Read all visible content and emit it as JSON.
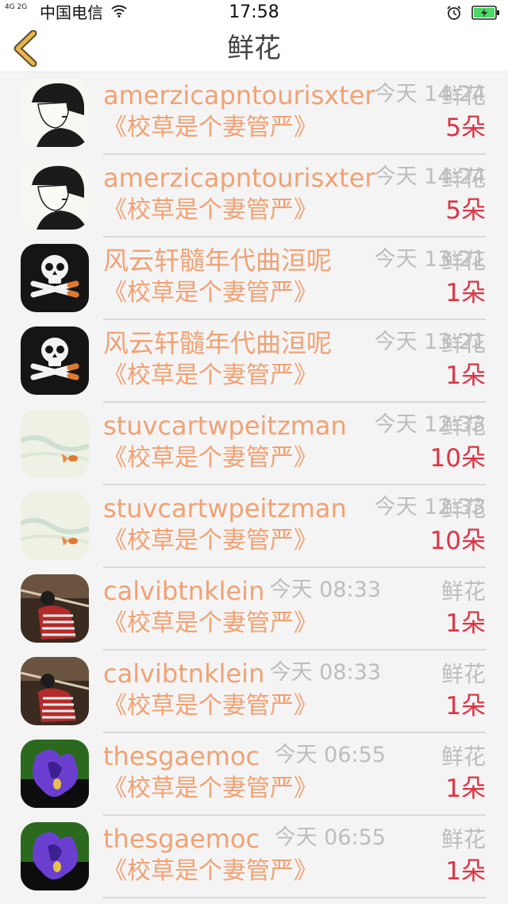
{
  "status_bar": {
    "network": "4G 2G",
    "carrier": "中国电信",
    "time": "17:58"
  },
  "header": {
    "title": "鲜花"
  },
  "colors": {
    "name": "#f0a274",
    "count": "#dc3545",
    "meta": "#bdbdbd",
    "back_icon": "#e8b64a"
  },
  "rows": [
    {
      "avatar": "avatar-manga-boy-icon",
      "name": "amerzicapntourisxter",
      "time": "今天 14:24",
      "label": "鲜花",
      "book": "《校草是个妻管严》",
      "count": "5朵"
    },
    {
      "avatar": "avatar-manga-boy-icon",
      "name": "amerzicapntourisxter",
      "time": "今天 14:24",
      "label": "鲜花",
      "book": "《校草是个妻管严》",
      "count": "5朵"
    },
    {
      "avatar": "avatar-skull-icon",
      "name": "风云轩髓年代曲洹呢",
      "time": "今天 13:21",
      "label": "鲜花",
      "book": "《校草是个妻管严》",
      "count": "1朵"
    },
    {
      "avatar": "avatar-skull-icon",
      "name": "风云轩髓年代曲洹呢",
      "time": "今天 13:21",
      "label": "鲜花",
      "book": "《校草是个妻管严》",
      "count": "1朵"
    },
    {
      "avatar": "avatar-goldfish-icon",
      "name": "stuvcartwpeitzman",
      "time": "今天 12:33",
      "label": "鲜花",
      "book": "《校草是个妻管严》",
      "count": "10朵"
    },
    {
      "avatar": "avatar-goldfish-icon",
      "name": "stuvcartwpeitzman",
      "time": "今天 12:33",
      "label": "鲜花",
      "book": "《校草是个妻管严》",
      "count": "10朵"
    },
    {
      "avatar": "avatar-photo-person-icon",
      "name": "calvibtnklein",
      "time": "今天 08:33",
      "label": "鲜花",
      "book": "《校草是个妻管严》",
      "count": "1朵"
    },
    {
      "avatar": "avatar-photo-person-icon",
      "name": "calvibtnklein",
      "time": "今天 08:33",
      "label": "鲜花",
      "book": "《校草是个妻管严》",
      "count": "1朵"
    },
    {
      "avatar": "avatar-purple-flower-icon",
      "name": "thesgaemoc",
      "time": "今天 06:55",
      "label": "鲜花",
      "book": "《校草是个妻管严》",
      "count": "1朵"
    },
    {
      "avatar": "avatar-purple-flower-icon",
      "name": "thesgaemoc",
      "time": "今天 06:55",
      "label": "鲜花",
      "book": "《校草是个妻管严》",
      "count": "1朵"
    }
  ]
}
